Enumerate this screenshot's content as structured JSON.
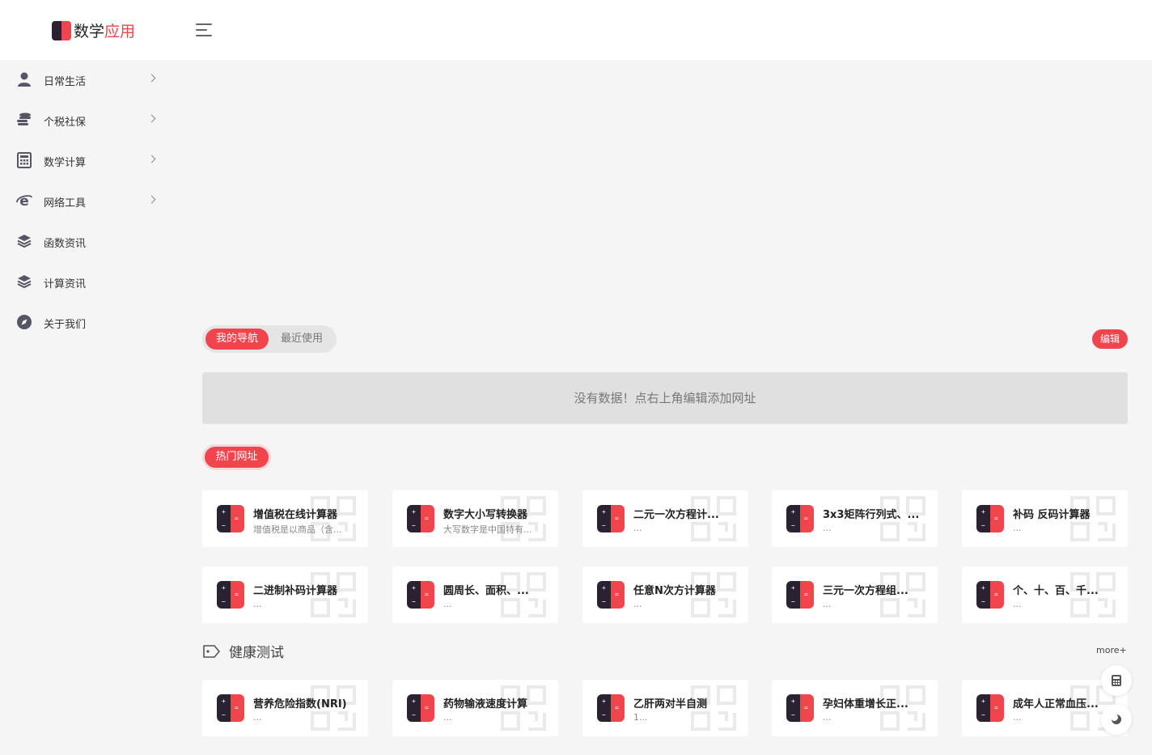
{
  "app": {
    "title_part1": "数学",
    "title_part2": "应用"
  },
  "colors": {
    "accent": "#f0454d",
    "dark": "#2a2230"
  },
  "sidebar": {
    "items": [
      {
        "label": "日常生活",
        "icon": "user-icon",
        "has_children": true
      },
      {
        "label": "个税社保",
        "icon": "coins-icon",
        "has_children": true
      },
      {
        "label": "数学计算",
        "icon": "calculator-icon",
        "has_children": true
      },
      {
        "label": "网络工具",
        "icon": "ie-browser-icon",
        "has_children": true
      },
      {
        "label": "函数资讯",
        "icon": "layers-icon",
        "has_children": false
      },
      {
        "label": "计算资讯",
        "icon": "layers-icon",
        "has_children": false
      },
      {
        "label": "关于我们",
        "icon": "compass-icon",
        "has_children": false
      }
    ]
  },
  "nav_tabs": {
    "active": "我的导航",
    "inactive": "最近使用"
  },
  "edit_label": "编辑",
  "empty_message": "没有数据！点右上角编辑添加网址",
  "hot_label": "热门网址",
  "hot_cards": [
    {
      "title": "增值税在线计算器",
      "desc": "增值税是以商品（含..."
    },
    {
      "title": "数字大小写转换器",
      "desc": "大写数字是中国特有..."
    },
    {
      "title": "二元一次方程计...",
      "desc": "..."
    },
    {
      "title": "3x3矩阵行列式、...",
      "desc": "..."
    },
    {
      "title": "补码 反码计算器",
      "desc": "..."
    },
    {
      "title": "二进制补码计算器",
      "desc": "..."
    },
    {
      "title": "圆周长、面积、...",
      "desc": "..."
    },
    {
      "title": "任意N次方计算器",
      "desc": "..."
    },
    {
      "title": "三元一次方程组...",
      "desc": "..."
    },
    {
      "title": "个、十、百、千...",
      "desc": "..."
    }
  ],
  "health_section": {
    "title": "健康测试",
    "more": "more+"
  },
  "health_cards": [
    {
      "title": "营养危险指数(NRI)",
      "desc": "..."
    },
    {
      "title": "药物输液速度计算",
      "desc": "..."
    },
    {
      "title": "乙肝两对半自测",
      "desc": "1..."
    },
    {
      "title": "孕妇体重增长正...",
      "desc": "..."
    },
    {
      "title": "成年人正常血压...",
      "desc": "..."
    }
  ]
}
